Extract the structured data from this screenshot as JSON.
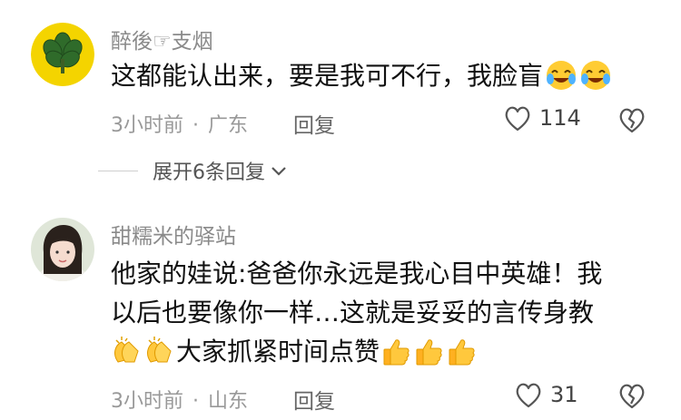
{
  "comments": [
    {
      "username": "醉後☞支烟",
      "text_lines": [
        "这都能认出来，要是我可不行，我脸盲"
      ],
      "time": "3小时前",
      "location": "广东",
      "reply_label": "回复",
      "likes": "114"
    },
    {
      "username": "甜糯米的驿站",
      "text_lines": [
        "他家的娃说:爸爸你永远是我心目中英雄！我",
        "以后也要像你一样…这就是妥妥的言传身教",
        "大家抓紧时间点赞"
      ],
      "time": "3小时前",
      "location": "山东",
      "reply_label": "回复",
      "likes": "31"
    }
  ],
  "expand_replies": "展开6条回复",
  "dot": "·",
  "icons": {
    "like": "heart-icon",
    "dislike": "broken-heart-icon",
    "expand": "chevron-down-icon",
    "emoji1": "laughing-tears-emoji",
    "emoji2": "clapping-hands-emoji",
    "emoji3": "thumbs-up-emoji"
  },
  "colors": {
    "username": "#8a8a8a",
    "text": "#111111",
    "meta": "#999999"
  }
}
